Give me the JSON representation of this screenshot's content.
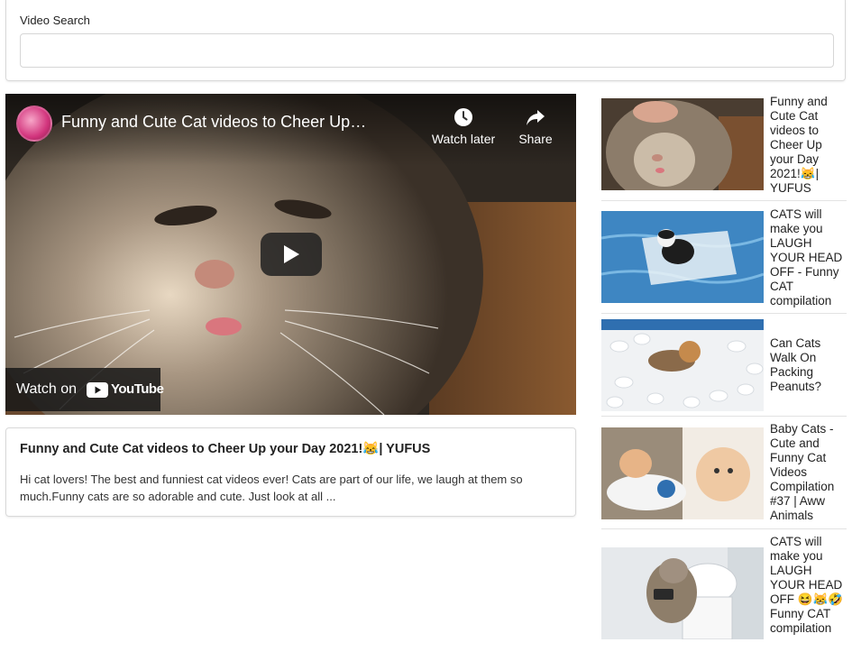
{
  "search": {
    "label": "Video Search",
    "value": "",
    "placeholder": ""
  },
  "player": {
    "title": "Funny and Cute Cat videos to Cheer Up your Day 2021! 😹 | YUFUS",
    "watch_later_label": "Watch later",
    "share_label": "Share",
    "watch_on_label": "Watch on",
    "youtube_wordmark": "YouTube"
  },
  "details": {
    "title": "Funny and Cute Cat videos to Cheer Up your Day 2021!😹| YUFUS",
    "description": "Hi cat lovers! The best and funniest cat videos ever! Cats are part of our life, we laugh at them so much.Funny cats are so adorable and cute. Just look at all ..."
  },
  "videos": [
    {
      "title": "Funny and Cute Cat videos to Cheer Up your Day 2021!😹| YUFUS"
    },
    {
      "title": "CATS will make you LAUGH YOUR HEAD OFF - Funny CAT compilation"
    },
    {
      "title": "Can Cats Walk On Packing Peanuts?"
    },
    {
      "title": "Baby Cats - Cute and Funny Cat Videos Compilation #37 | Aww Animals"
    },
    {
      "title": "CATS will make you LAUGH YOUR HEAD OFF 😆😹🤣 Funny CAT compilation"
    }
  ],
  "colors": {
    "youtube_red": "#ff0000",
    "border": "#d9d9d9"
  }
}
